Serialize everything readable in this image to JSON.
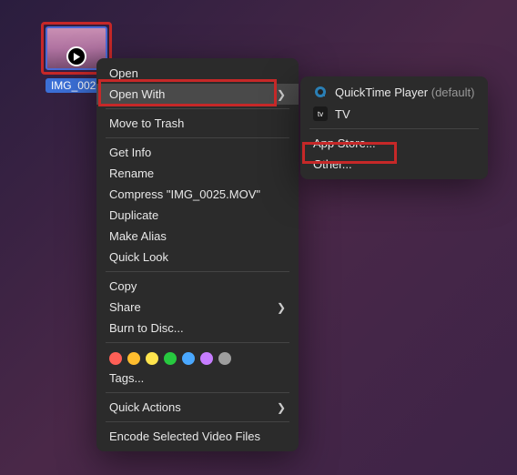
{
  "file": {
    "name": "IMG_0025"
  },
  "mainMenu": {
    "open": "Open",
    "openWith": "Open With",
    "moveToTrash": "Move to Trash",
    "getInfo": "Get Info",
    "rename": "Rename",
    "compress": "Compress \"IMG_0025.MOV\"",
    "duplicate": "Duplicate",
    "makeAlias": "Make Alias",
    "quickLook": "Quick Look",
    "copy": "Copy",
    "share": "Share",
    "burn": "Burn to Disc...",
    "tags": "Tags...",
    "quickActions": "Quick Actions",
    "encode": "Encode Selected Video Files"
  },
  "submenu": {
    "quicktime": "QuickTime Player",
    "quicktimeDefault": "(default)",
    "tv": "TV",
    "appStore": "App Store...",
    "other": "Other..."
  },
  "tagColors": [
    "#ff5f56",
    "#ffbd2e",
    "#ffe44d",
    "#27c93f",
    "#4aa8ff",
    "#c77dff",
    "#9e9e9e"
  ]
}
